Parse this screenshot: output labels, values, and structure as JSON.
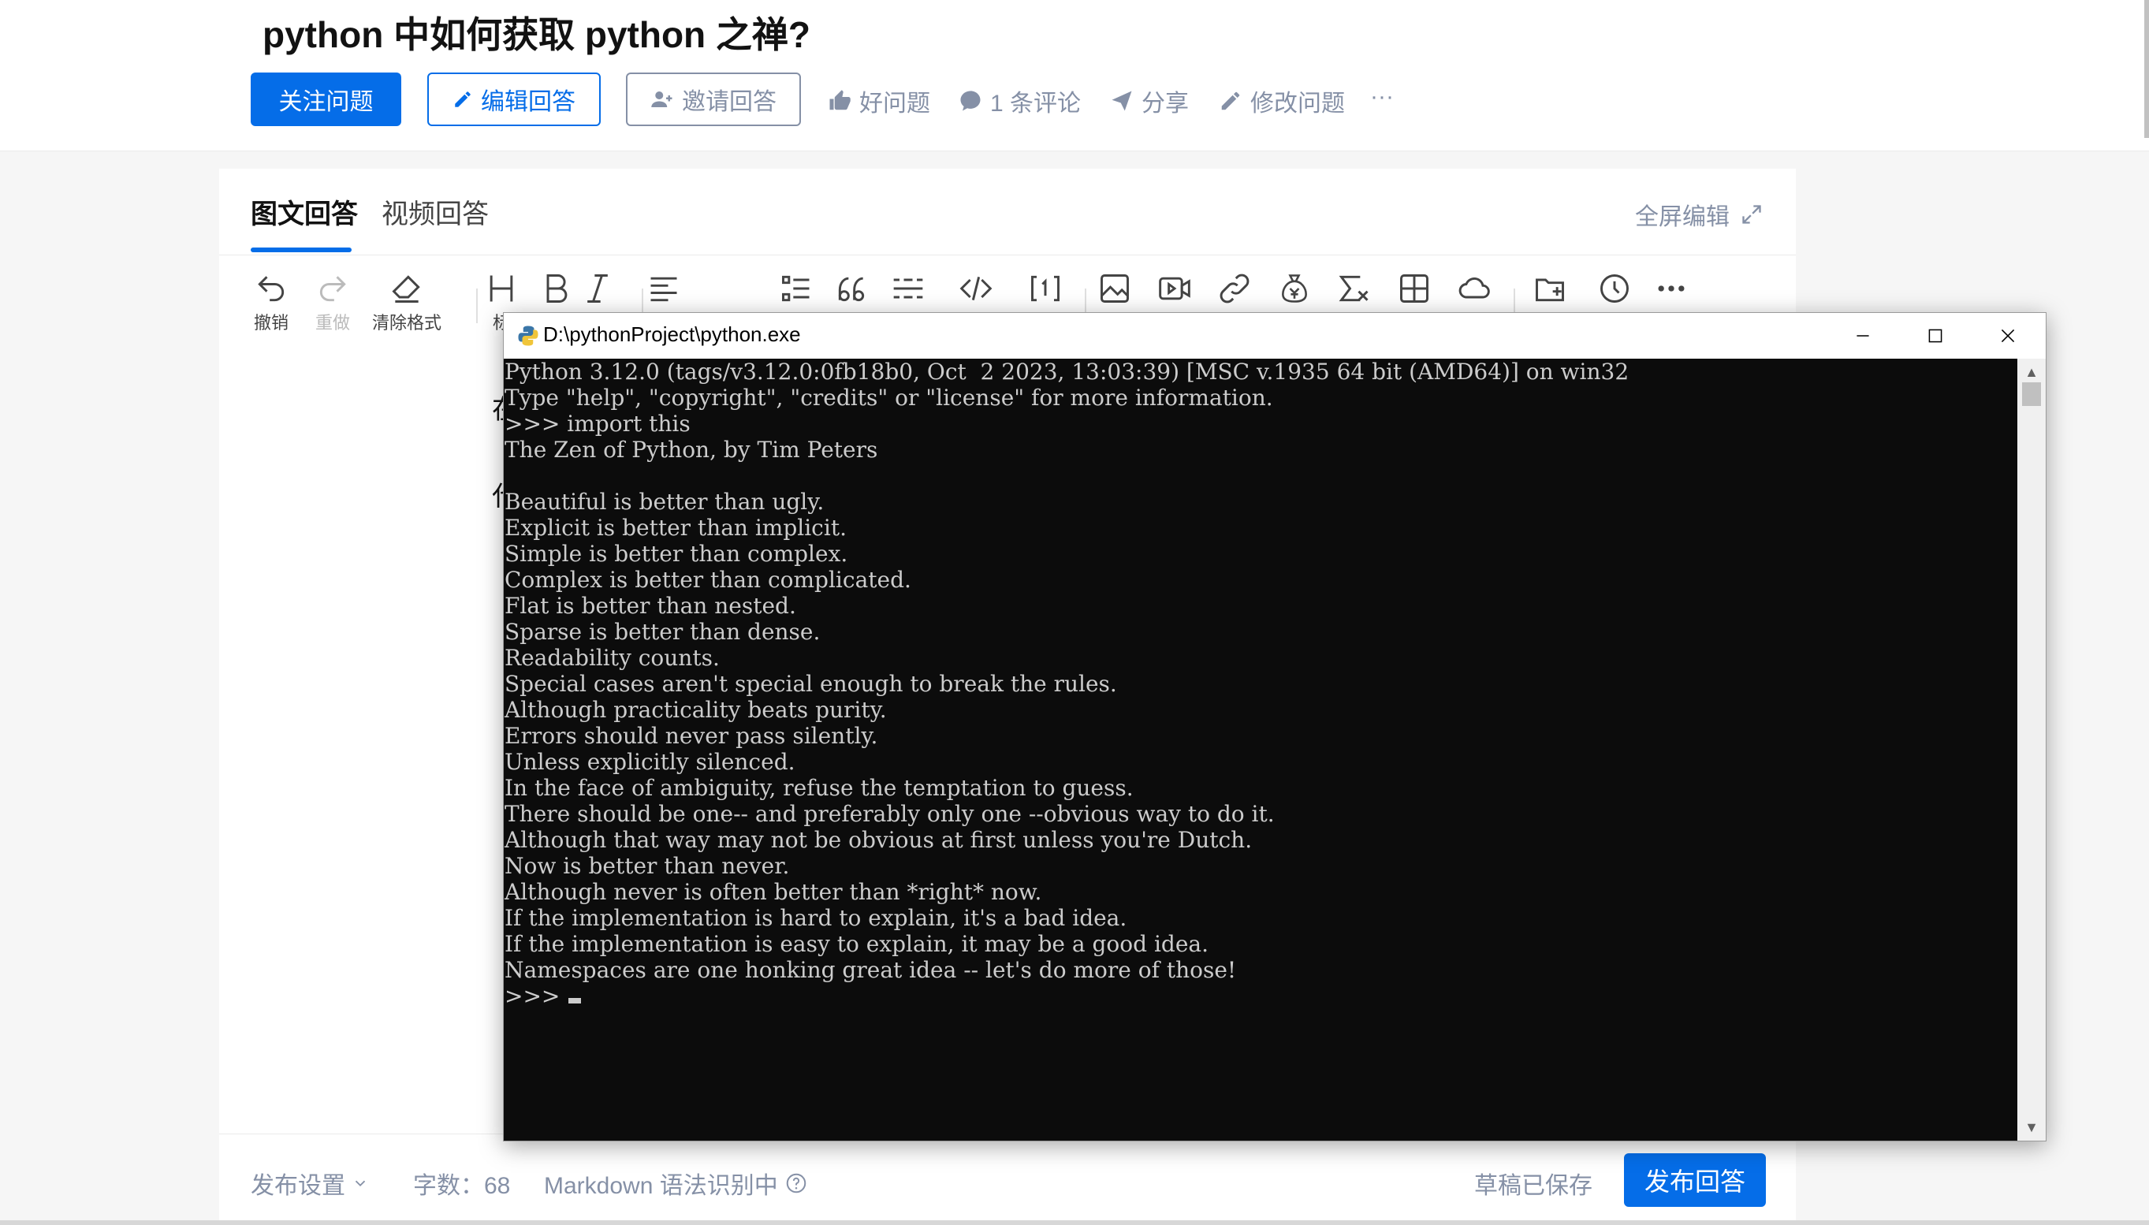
{
  "question": {
    "title": "python 中如何获取 python 之禅?",
    "buttons": {
      "follow": "关注问题",
      "edit_answer": "编辑回答",
      "invite_answer": "邀请回答"
    },
    "actions": {
      "good_question": "好问题",
      "comments": "1 条评论",
      "share": "分享",
      "edit_question": "修改问题",
      "more": "···"
    }
  },
  "editor": {
    "tabs": [
      "图文回答",
      "视频回答"
    ],
    "fullscreen": "全屏编辑",
    "toolbar": {
      "undo": "撤销",
      "redo": "重做",
      "clear_format": "清除格式",
      "heading": "标"
    },
    "content_fragments": [
      "在",
      "代"
    ],
    "footer": {
      "publish_settings": "发布设置",
      "word_count": "字数：68",
      "markdown": "Markdown 语法识别中",
      "draft_saved": "草稿已保存",
      "publish": "发布回答"
    }
  },
  "console": {
    "title": "D:\\pythonProject\\python.exe",
    "lines": [
      "Python 3.12.0 (tags/v3.12.0:0fb18b0, Oct  2 2023, 13:03:39) [MSC v.1935 64 bit (AMD64)] on win32",
      "Type \"help\", \"copyright\", \"credits\" or \"license\" for more information.",
      ">>> import this",
      "The Zen of Python, by Tim Peters",
      "",
      "Beautiful is better than ugly.",
      "Explicit is better than implicit.",
      "Simple is better than complex.",
      "Complex is better than complicated.",
      "Flat is better than nested.",
      "Sparse is better than dense.",
      "Readability counts.",
      "Special cases aren't special enough to break the rules.",
      "Although practicality beats purity.",
      "Errors should never pass silently.",
      "Unless explicitly silenced.",
      "In the face of ambiguity, refuse the temptation to guess.",
      "There should be one-- and preferably only one --obvious way to do it.",
      "Although that way may not be obvious at first unless you're Dutch.",
      "Now is better than never.",
      "Although never is often better than *right* now.",
      "If the implementation is hard to explain, it's a bad idea.",
      "If the implementation is easy to explain, it may be a good idea.",
      "Namespaces are one honking great idea -- let's do more of those!"
    ],
    "prompt": ">>> "
  },
  "colors": {
    "accent": "#056de8",
    "muted": "#8590a6",
    "terminal_bg": "#0c0c0c",
    "terminal_fg": "#cccccc"
  }
}
